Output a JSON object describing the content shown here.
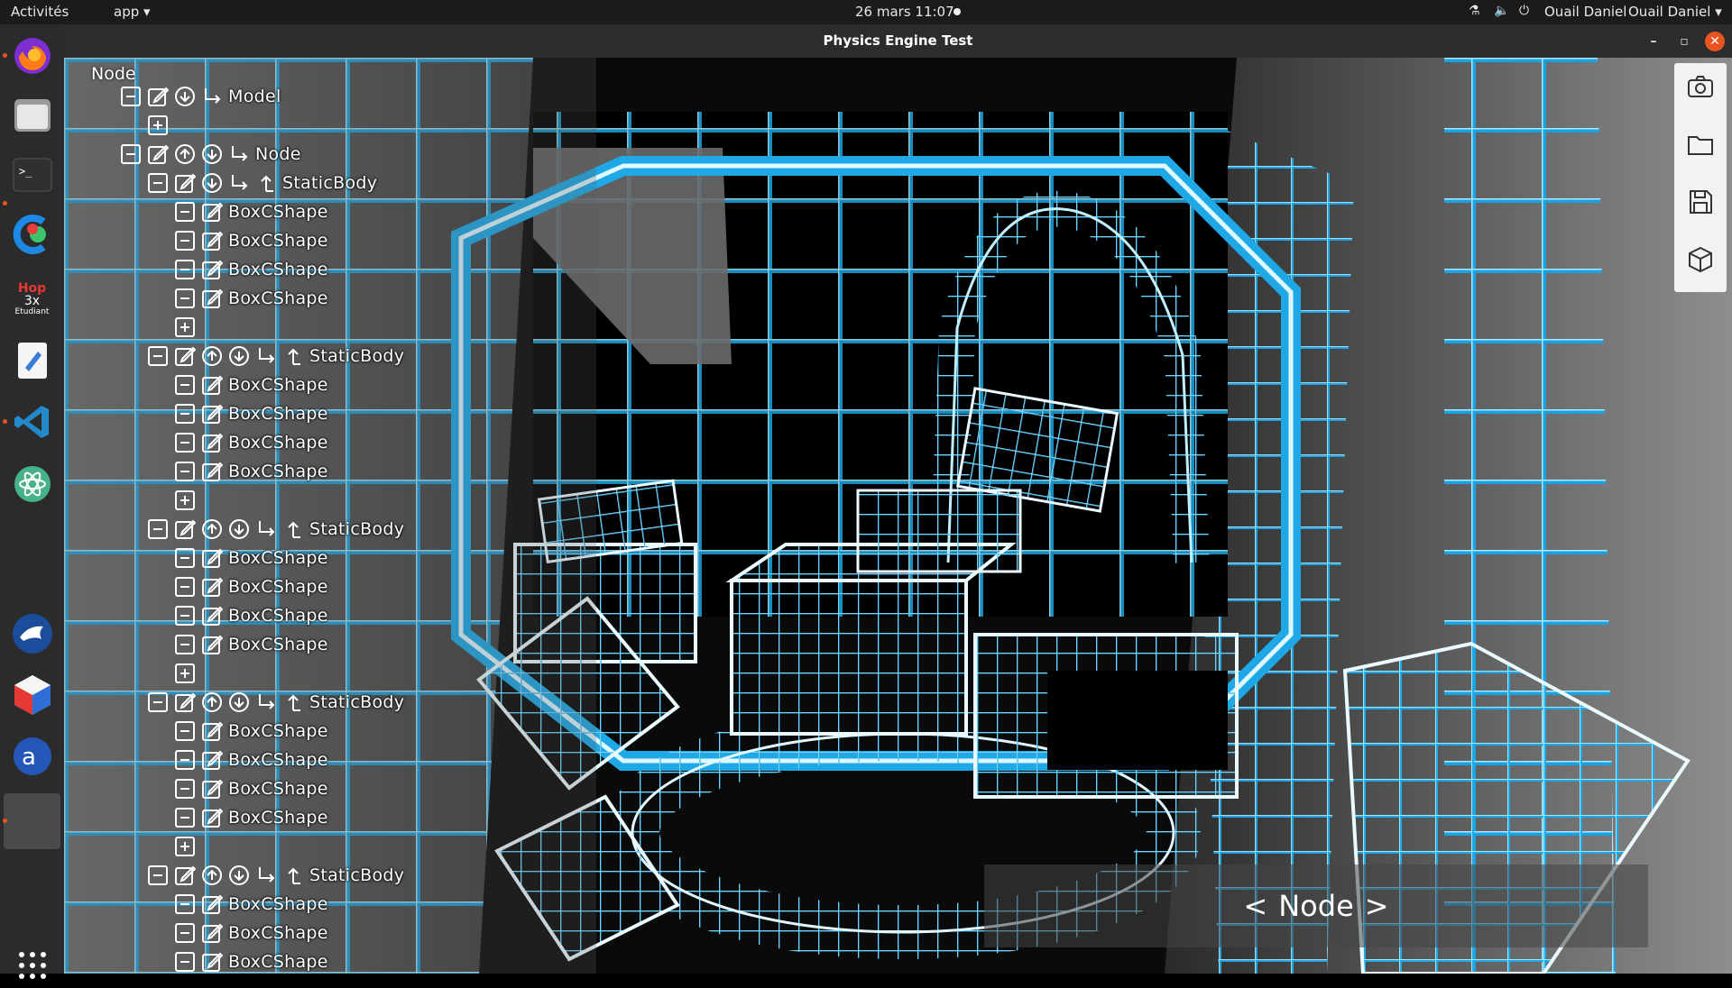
{
  "topbar": {
    "activities": "Activités",
    "app_menu": "app",
    "app_arrow": "▾",
    "clock": "26 mars  11:07",
    "user1": "Ouail Daniel",
    "user2": "Ouail Daniel",
    "user_arrow": "▾"
  },
  "window": {
    "title": "Physics Engine Test",
    "minimize": "–",
    "maximize": "▫",
    "close": "✕"
  },
  "dock": {
    "items": [
      "firefox-icon",
      "files-icon",
      "terminal-icon",
      "clion-icon",
      "hop3x-icon",
      "text-editor-icon",
      "vscode-icon",
      "atom-icon",
      "gnome-shell-icon",
      "cube-app-icon",
      "anki-icon",
      "active-window-icon"
    ],
    "hop_text": "Hop",
    "hop_sub": "3x",
    "hop_caption": "Etudiant"
  },
  "tree": {
    "root": "Node",
    "model": "Model",
    "node": "Node",
    "static_body": "StaticBody",
    "box_shape": "BoxCShape"
  },
  "nav": {
    "prev": "<",
    "label": "Node",
    "next": ">"
  },
  "colors": {
    "wire": "#1ea8e6",
    "wire_bright": "#8fe3ff",
    "accent_close": "#e95420"
  }
}
